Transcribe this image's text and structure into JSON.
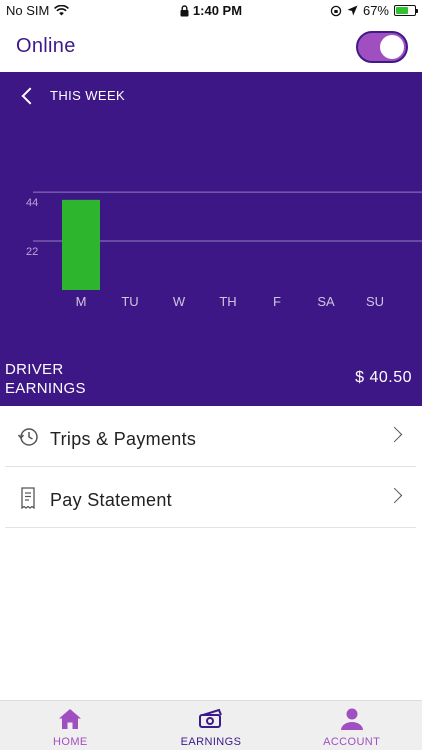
{
  "status_bar": {
    "carrier": "No SIM",
    "time": "1:40 PM",
    "battery": "67%",
    "battery_level": 0.67
  },
  "header": {
    "title": "Online",
    "online_toggle_on": true
  },
  "week_nav": {
    "label": "THIS WEEK"
  },
  "chart_data": {
    "type": "bar",
    "categories": [
      "M",
      "TU",
      "W",
      "TH",
      "F",
      "SA",
      "SU"
    ],
    "values": [
      40.5,
      0,
      0,
      0,
      0,
      0,
      0
    ],
    "yticks": [
      22,
      44
    ],
    "ylim": [
      0,
      62
    ],
    "bar_color": "#2db52d"
  },
  "earnings": {
    "label": "DRIVER EARNINGS",
    "value": "$ 40.50"
  },
  "list": [
    {
      "label": "Trips & Payments",
      "icon": "history-icon"
    },
    {
      "label": "Pay Statement",
      "icon": "receipt-icon"
    }
  ],
  "tabs": [
    {
      "label": "HOME",
      "icon": "home-icon",
      "active": false
    },
    {
      "label": "EARNINGS",
      "icon": "cash-icon",
      "active": true
    },
    {
      "label": "ACCOUNT",
      "icon": "person-icon",
      "active": false
    }
  ],
  "colors": {
    "brand_purple": "#3e1786",
    "accent_purple": "#a04fc0",
    "bar_green": "#2db52d"
  }
}
